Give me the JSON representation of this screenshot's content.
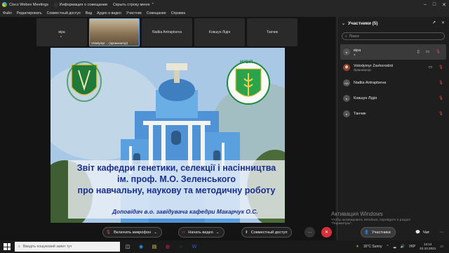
{
  "titlebar": {
    "app_title": "Cisco Webex Meetings",
    "meeting_info": "Информация о совещании",
    "hide_menu": "Скрыть строку меню"
  },
  "menu": [
    "Файл",
    "Редактировать",
    "Совместный доступ",
    "Вид",
    "Аудио и видео",
    "Участник",
    "Совещание",
    "Справка"
  ],
  "thumbnails": [
    {
      "name": "віра",
      "type": "blank"
    },
    {
      "name": "Volodymyr ... (организатор)",
      "type": "video"
    },
    {
      "name": "Nadiia Antraptseva",
      "type": "blank"
    },
    {
      "name": "Ковшун Лідія",
      "type": "blank"
    },
    {
      "name": "Танчик",
      "type": "blank"
    }
  ],
  "slide": {
    "title_lines": [
      "Звіт кафедри генетики, селекції і насінництва",
      "ім. проф. М.О. Зеленського",
      "про навчальну, наукову та методичну роботу"
    ],
    "presenter": "Доповідач в.о. завідувача кафедри Макарчук О.С.",
    "logo_right_text": "НУБіП"
  },
  "participants_panel": {
    "title": "Участники (5)",
    "search_placeholder": "Поиск",
    "participants": [
      {
        "name": "віра",
        "role": "",
        "initials": "",
        "active": true
      },
      {
        "name": "Volodymyr Zavhorodnii",
        "role": "Организатор",
        "initials": "",
        "active": false
      },
      {
        "name": "Nadiia Antraptseva",
        "role": "",
        "initials": "NA",
        "active": false
      },
      {
        "name": "Ковшун Лідія",
        "role": "",
        "initials": "",
        "active": false
      },
      {
        "name": "Танчик",
        "role": "",
        "initials": "",
        "active": false
      }
    ]
  },
  "watermark": {
    "title": "Активация Windows",
    "subtitle": "Чтобы активировать Windows, перейдите в раздел \"Параметры\"."
  },
  "controls": {
    "mic": "Включить микрофон",
    "video": "Начать видео",
    "share": "Совместный доступ",
    "participants": "Участники",
    "chat": "Чат"
  },
  "taskbar": {
    "search_placeholder": "Введіть пошуковий запит тут",
    "weather": "16°C Sunny",
    "lang": "УКР",
    "time": "14:14",
    "date": "22.10.2021"
  },
  "colors": {
    "accent": "#1fb8f0",
    "mic_off": "#e04848",
    "leave": "#d6313a",
    "slide_title": "#1b2f8f"
  }
}
